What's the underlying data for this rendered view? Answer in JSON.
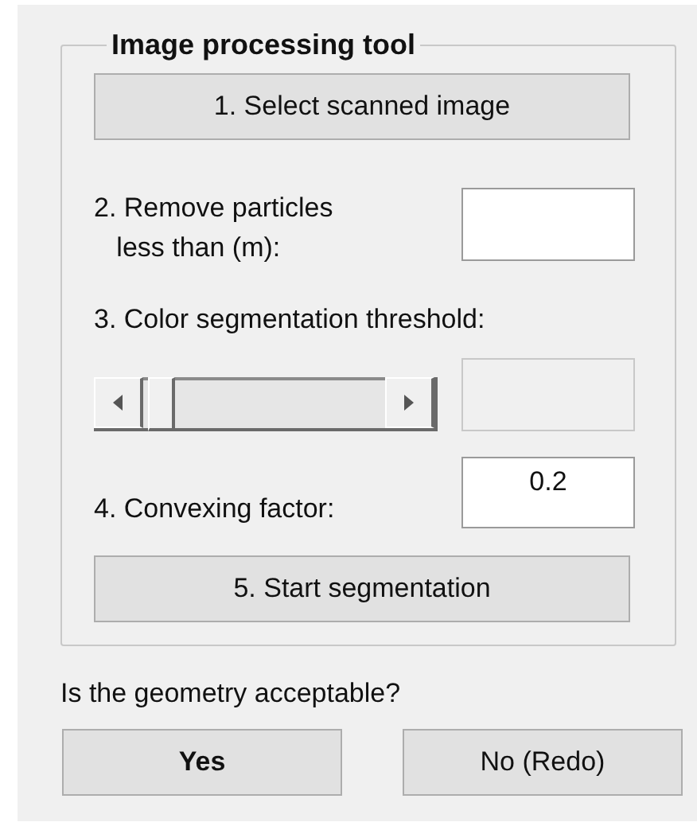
{
  "group": {
    "title": "Image processing tool"
  },
  "select_button": {
    "label": "1. Select scanned image"
  },
  "particles": {
    "label_line_1": "2. Remove particles",
    "label_line_2": "less than (m):"
  },
  "threshold": {
    "label": "3. Color segmentation threshold:",
    "level": 0.02,
    "disabled": true
  },
  "convexing": {
    "label": "4.  Convexing factor:",
    "value": "0.2"
  },
  "start_button": {
    "label": "5. Start segmentation"
  },
  "question": "Is the geometry acceptable?",
  "answers": [
    {
      "label": "Yes",
      "bold": true
    },
    {
      "label": "No (Redo)",
      "bold": false
    }
  ]
}
